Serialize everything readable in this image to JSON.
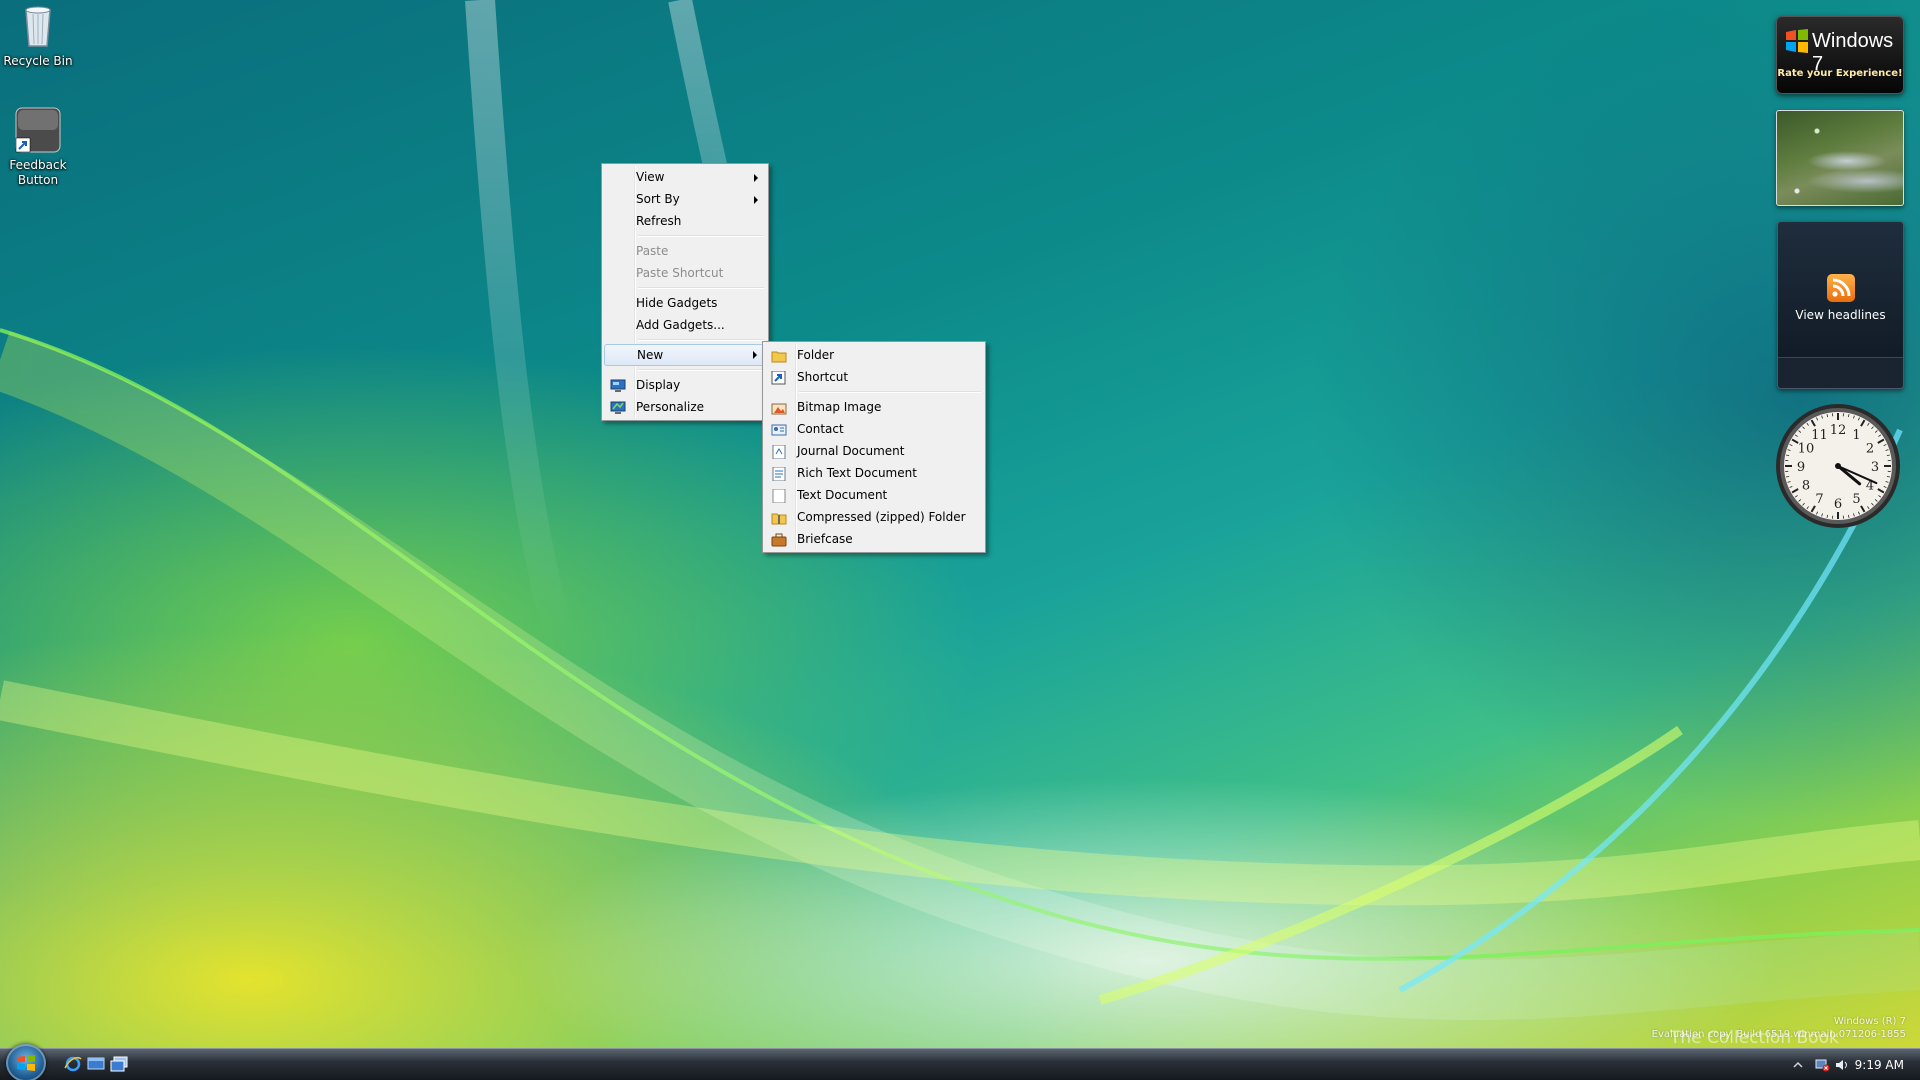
{
  "desktop": {
    "icons": [
      {
        "label": "Recycle Bin"
      },
      {
        "label": "Feedback Button"
      }
    ],
    "watermark": {
      "line1": "Windows (R) 7",
      "line2": "Evaluation copy. Build 6519.winmain.071206-1855",
      "overlay": "The Collection Book"
    }
  },
  "context_menu": {
    "items": [
      {
        "label": "View",
        "submenu": true
      },
      {
        "label": "Sort By",
        "submenu": true
      },
      {
        "label": "Refresh"
      },
      {
        "label": "Paste",
        "disabled": true
      },
      {
        "label": "Paste Shortcut",
        "disabled": true
      },
      {
        "label": "Hide Gadgets"
      },
      {
        "label": "Add Gadgets..."
      },
      {
        "label": "New",
        "submenu": true,
        "highlighted": true
      },
      {
        "label": "Display",
        "icon": "display-icon"
      },
      {
        "label": "Personalize",
        "icon": "personalize-icon"
      }
    ]
  },
  "new_submenu": {
    "items": [
      {
        "label": "Folder",
        "icon": "folder-icon"
      },
      {
        "label": "Shortcut",
        "icon": "shortcut-icon"
      },
      {
        "label": "Bitmap Image",
        "icon": "bitmap-icon"
      },
      {
        "label": "Contact",
        "icon": "contact-icon"
      },
      {
        "label": "Journal Document",
        "icon": "journal-icon"
      },
      {
        "label": "Rich Text Document",
        "icon": "rtf-icon"
      },
      {
        "label": "Text Document",
        "icon": "text-document-icon"
      },
      {
        "label": "Compressed (zipped) Folder",
        "icon": "zip-folder-icon"
      },
      {
        "label": "Briefcase",
        "icon": "briefcase-icon"
      }
    ]
  },
  "gadgets": {
    "win7": {
      "title": "Windows 7",
      "subtitle": "Rate your Experience!"
    },
    "feed": {
      "label": "View headlines"
    },
    "clock": {
      "hours": [
        "12",
        "1",
        "2",
        "3",
        "4",
        "5",
        "6",
        "7",
        "8",
        "9",
        "10",
        "11"
      ],
      "time_hour": 4,
      "time_minute": 19
    }
  },
  "taskbar": {
    "time": "9:19 AM"
  },
  "colors": {
    "menu_bg": "#f0f0f0",
    "menu_border": "#979797",
    "highlight_border": "#a8c8ec",
    "disabled_text": "#8d8d8d"
  }
}
